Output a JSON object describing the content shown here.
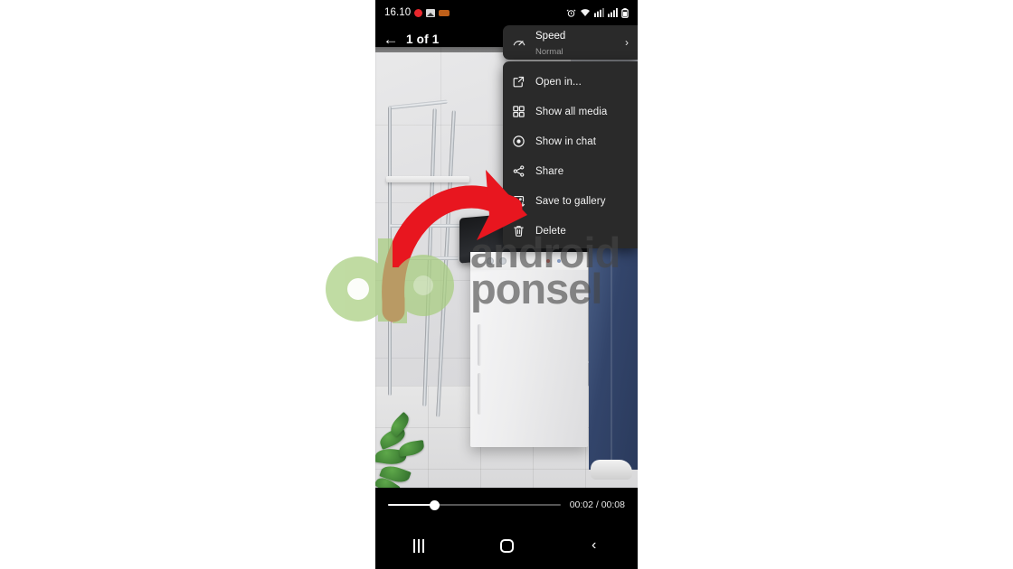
{
  "statusbar": {
    "time": "16.10",
    "left_icons": [
      "record-dot-icon",
      "image-icon",
      "orange-app-icon"
    ],
    "right_icons": [
      "alarm-icon",
      "wifi-icon",
      "mobile-data-icon",
      "signal-icon",
      "battery-icon"
    ]
  },
  "appbar": {
    "back_icon": "←",
    "title": "1 of 1"
  },
  "menu": {
    "speed": {
      "icon": "speedometer-icon",
      "label": "Speed",
      "value": "Normal",
      "chevron": "›"
    },
    "items": [
      {
        "icon": "open-external-icon",
        "label": "Open in..."
      },
      {
        "icon": "grid-icon",
        "label": "Show all media"
      },
      {
        "icon": "eye-icon",
        "label": "Show in chat"
      },
      {
        "icon": "share-icon",
        "label": "Share"
      },
      {
        "icon": "save-image-icon",
        "label": "Save to gallery"
      },
      {
        "icon": "trash-icon",
        "label": "Delete"
      }
    ]
  },
  "annotation": {
    "type": "curved-arrow",
    "color": "#E8161F",
    "points_to": "Share"
  },
  "watermark": {
    "logo": "dp-logo",
    "line1": "android",
    "line2": "ponsel",
    "logo_color": "#A8CE7F",
    "text_color": "#464646"
  },
  "player": {
    "current_time": "00:02",
    "total_time": "00:08",
    "time_display": "00:02 / 00:08",
    "progress_percent": 27
  },
  "navbar": {
    "recents_label": "recents-button",
    "home_label": "home-button",
    "back_label": "back-button",
    "back_glyph": "‹"
  },
  "media": {
    "description": "white top-load washing machine in a laundry room, person in striped shirt and blue jeans"
  }
}
